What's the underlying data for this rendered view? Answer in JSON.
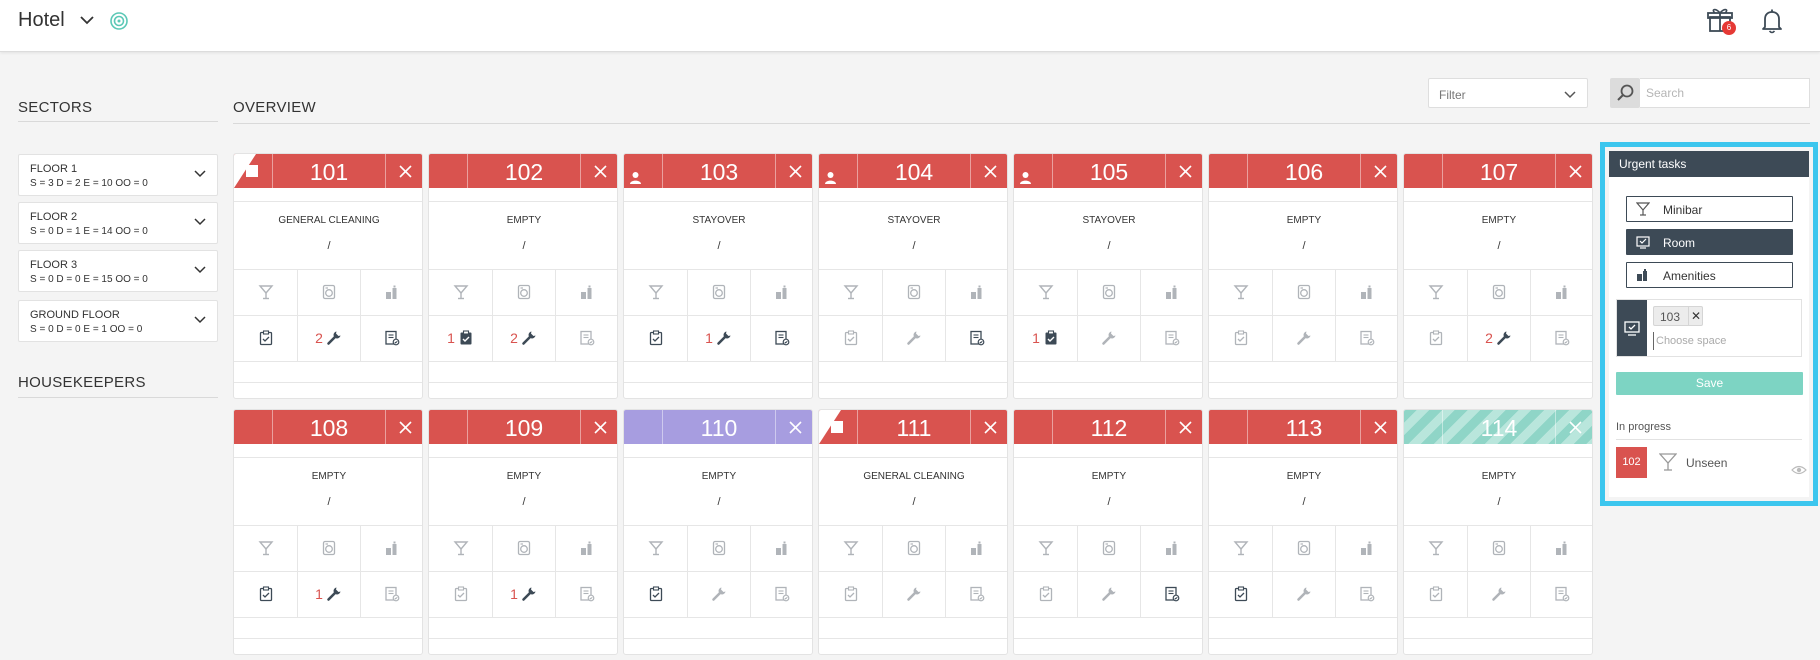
{
  "header": {
    "title": "Hotel",
    "notification_count": "6"
  },
  "sectors": {
    "heading": "SECTORS",
    "floors": [
      {
        "name": "FLOOR 1",
        "stats": "S = 3 D = 2 E = 10 OO = 0"
      },
      {
        "name": "FLOOR 2",
        "stats": "S = 0 D = 1 E = 14 OO = 0"
      },
      {
        "name": "FLOOR 3",
        "stats": "S = 0 D = 0 E = 15 OO = 0"
      },
      {
        "name": "GROUND FLOOR",
        "stats": "S = 0 D = 0 E = 1 OO = 0"
      }
    ]
  },
  "housekeepers": {
    "heading": "HOUSEKEEPERS"
  },
  "overview": {
    "heading": "OVERVIEW",
    "filter_label": "Filter",
    "search_placeholder": "Search"
  },
  "rooms": [
    {
      "number": "101",
      "status": "GENERAL CLEANING",
      "slash": "/",
      "color": "red",
      "flag": true,
      "guest": false,
      "tasks": {
        "count": "",
        "maint": "2",
        "note_active": true
      },
      "task_active": false,
      "maint_active": true,
      "check_active": true
    },
    {
      "number": "102",
      "status": "EMPTY",
      "slash": "/",
      "color": "red",
      "flag": false,
      "guest": false,
      "tasks": {
        "count": "1",
        "maint": "2",
        "note_active": false
      },
      "task_active": true,
      "maint_active": true,
      "check_active": true
    },
    {
      "number": "103",
      "status": "STAYOVER",
      "slash": "/",
      "color": "red",
      "flag": false,
      "guest": true,
      "tasks": {
        "count": "",
        "maint": "1",
        "note_active": true
      },
      "task_active": false,
      "maint_active": true,
      "check_active": true
    },
    {
      "number": "104",
      "status": "STAYOVER",
      "slash": "/",
      "color": "red",
      "flag": false,
      "guest": true,
      "tasks": {
        "count": "",
        "maint": "",
        "note_active": true
      },
      "task_active": false,
      "maint_active": false,
      "check_active": false
    },
    {
      "number": "105",
      "status": "STAYOVER",
      "slash": "/",
      "color": "red",
      "flag": false,
      "guest": true,
      "tasks": {
        "count": "1",
        "maint": "",
        "note_active": false
      },
      "task_active": true,
      "maint_active": false,
      "check_active": false
    },
    {
      "number": "106",
      "status": "EMPTY",
      "slash": "/",
      "color": "red",
      "flag": false,
      "guest": false,
      "tasks": {
        "count": "",
        "maint": "",
        "note_active": false
      },
      "task_active": false,
      "maint_active": false,
      "check_active": false
    },
    {
      "number": "107",
      "status": "EMPTY",
      "slash": "/",
      "color": "red",
      "flag": false,
      "guest": false,
      "tasks": {
        "count": "",
        "maint": "2",
        "note_active": false
      },
      "task_active": false,
      "maint_active": true,
      "check_active": false
    },
    {
      "number": "108",
      "status": "EMPTY",
      "slash": "/",
      "color": "red",
      "flag": false,
      "guest": false,
      "tasks": {
        "count": "",
        "maint": "1",
        "note_active": false
      },
      "task_active": false,
      "maint_active": true,
      "check_active": true
    },
    {
      "number": "109",
      "status": "EMPTY",
      "slash": "/",
      "color": "red",
      "flag": false,
      "guest": false,
      "tasks": {
        "count": "",
        "maint": "1",
        "note_active": false
      },
      "task_active": false,
      "maint_active": true,
      "check_active": false
    },
    {
      "number": "110",
      "status": "EMPTY",
      "slash": "/",
      "color": "purple",
      "flag": false,
      "guest": false,
      "tasks": {
        "count": "",
        "maint": "",
        "note_active": false
      },
      "task_active": false,
      "maint_active": false,
      "check_active": true
    },
    {
      "number": "111",
      "status": "GENERAL CLEANING",
      "slash": "/",
      "color": "red",
      "flag": true,
      "guest": false,
      "tasks": {
        "count": "",
        "maint": "",
        "note_active": false
      },
      "task_active": false,
      "maint_active": false,
      "check_active": false
    },
    {
      "number": "112",
      "status": "EMPTY",
      "slash": "/",
      "color": "red",
      "flag": false,
      "guest": false,
      "tasks": {
        "count": "",
        "maint": "",
        "note_active": true
      },
      "task_active": false,
      "maint_active": false,
      "check_active": false
    },
    {
      "number": "113",
      "status": "EMPTY",
      "slash": "/",
      "color": "red",
      "flag": false,
      "guest": false,
      "tasks": {
        "count": "",
        "maint": "",
        "note_active": false
      },
      "task_active": false,
      "maint_active": false,
      "check_active": true
    },
    {
      "number": "114",
      "status": "EMPTY",
      "slash": "/",
      "color": "striped",
      "flag": false,
      "guest": false,
      "tasks": {
        "count": "",
        "maint": "",
        "note_active": false
      },
      "task_active": false,
      "maint_active": false,
      "check_active": false
    }
  ],
  "urgent": {
    "title": "Urgent tasks",
    "categories": [
      {
        "label": "Minibar",
        "icon": "glass-icon",
        "active": false
      },
      {
        "label": "Room",
        "icon": "room-monitor-icon",
        "active": true
      },
      {
        "label": "Amenities",
        "icon": "amenities-icon",
        "active": false
      }
    ],
    "selected_space": "103",
    "space_placeholder": "Choose space",
    "save_label": "Save",
    "in_progress_label": "In progress",
    "in_progress": [
      {
        "room": "102",
        "icon": "glass-icon",
        "state": "Unseen"
      }
    ]
  },
  "colors": {
    "red": "#d9534f",
    "purple": "#a79de0",
    "teal": "#8fd5c7",
    "dark": "#3d4a56",
    "highlight": "#3cc6ee",
    "save": "#7dd4c3"
  }
}
